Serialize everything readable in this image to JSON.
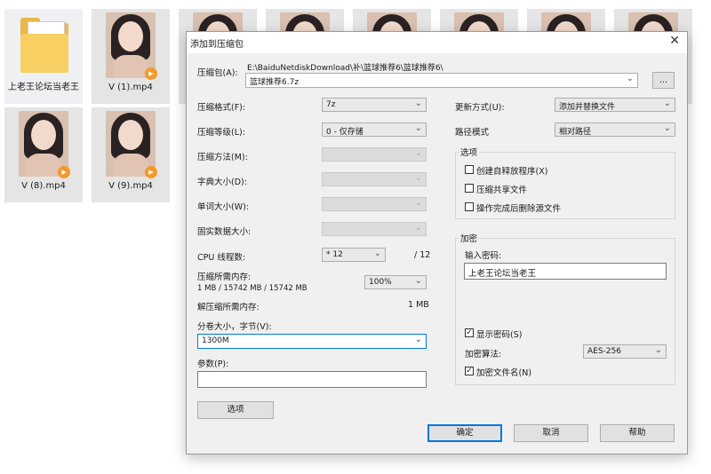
{
  "desktop": {
    "files": [
      {
        "label": "上老王论坛当老王",
        "type": "folder"
      },
      {
        "label": "V (1).mp4",
        "type": "video"
      },
      {
        "label": "V (8).mp4",
        "type": "video"
      },
      {
        "label": "V (9).mp4",
        "type": "video"
      }
    ]
  },
  "dialog": {
    "title": "添加到压缩包",
    "close": "✕",
    "archive_label": "压缩包(A):",
    "archive_path": "E:\\BaiduNetdiskDownload\\补\\篮球推荐6\\篮球推荐6\\",
    "archive_name": "篮球推荐6.7z",
    "browse": "...",
    "format_label": "压缩格式(F):",
    "format_value": "7z",
    "level_label": "压缩等级(L):",
    "level_value": "0 - 仅存储",
    "method_label": "压缩方法(M):",
    "dict_label": "字典大小(D):",
    "word_label": "单词大小(W):",
    "solid_label": "固实数据大小:",
    "threads_label": "CPU 线程数:",
    "threads_value": "* 12",
    "threads_total": "/ 12",
    "mem_comp_label": "压缩所需内存:",
    "mem_comp_value": "1 MB / 15742 MB / 15742 MB",
    "mem_percent": "100%",
    "mem_decomp_label": "解压缩所需内存:",
    "mem_decomp_value": "1 MB",
    "volume_label": "分卷大小，字节(V):",
    "volume_value": "1300M",
    "params_label": "参数(P):",
    "params_value": "",
    "options_button": "选项",
    "update_label": "更新方式(U):",
    "update_value": "添加并替换文件",
    "path_label": "路径模式",
    "path_value": "相对路径",
    "options_group": "选项",
    "opt_sfx": "创建自释放程序(X)",
    "opt_shared": "压缩共享文件",
    "opt_delete": "操作完成后删除源文件",
    "encrypt_group": "加密",
    "password_label": "输入密码:",
    "password_value": "上老王论坛当老王",
    "show_password": "显示密码(S)",
    "enc_method_label": "加密算法:",
    "enc_method_value": "AES-256",
    "encrypt_names": "加密文件名(N)",
    "ok": "确定",
    "cancel": "取消",
    "help": "帮助",
    "check_mark": "✓",
    "arrow": "⌄"
  }
}
